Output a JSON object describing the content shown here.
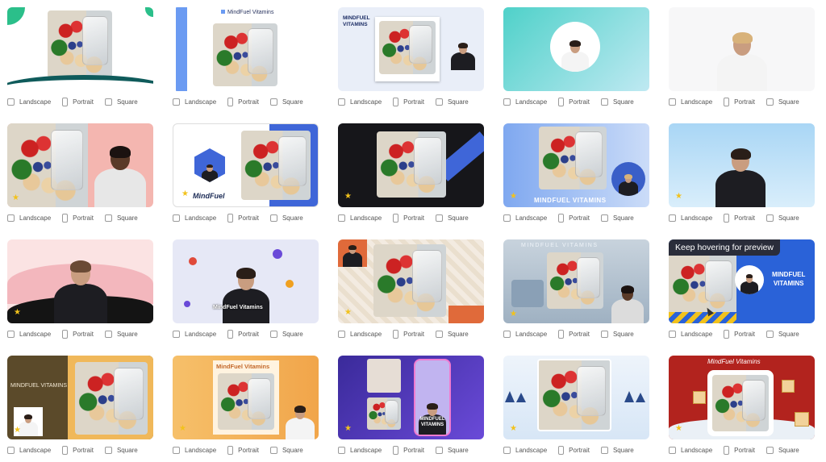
{
  "options": {
    "landscape": "Landscape",
    "portrait": "Portrait",
    "square": "Square"
  },
  "brand_text": {
    "mindfuel_vitamins": "MindFuel Vitamins",
    "mindfuel_vitamins_upper": "MINDFUEL VITAMINS",
    "mindfuel_vitamins_lines": [
      "MINDFUEL",
      "VITAMINS"
    ],
    "mindfuel_script": "MindFuel",
    "mindfuel_wide": "MINDFUEL VITAMINS",
    "mindfuel_orange_header": "MindFuel Vitamins",
    "mindfuel_red_script": "MindFuel Vitamins"
  },
  "tooltip": "Keep hovering for preview",
  "templates": [
    {
      "id": 1
    },
    {
      "id": 2
    },
    {
      "id": 3
    },
    {
      "id": 4
    },
    {
      "id": 5
    },
    {
      "id": 6
    },
    {
      "id": 7
    },
    {
      "id": 8
    },
    {
      "id": 9
    },
    {
      "id": 10
    },
    {
      "id": 11
    },
    {
      "id": 12
    },
    {
      "id": 13
    },
    {
      "id": 14
    },
    {
      "id": 15
    },
    {
      "id": 16
    },
    {
      "id": 17
    },
    {
      "id": 18
    },
    {
      "id": 19
    },
    {
      "id": 20
    }
  ],
  "colors": {
    "star": "#f2c21c",
    "checkbox_border": "#9a9a9a",
    "label_text": "#555555"
  }
}
